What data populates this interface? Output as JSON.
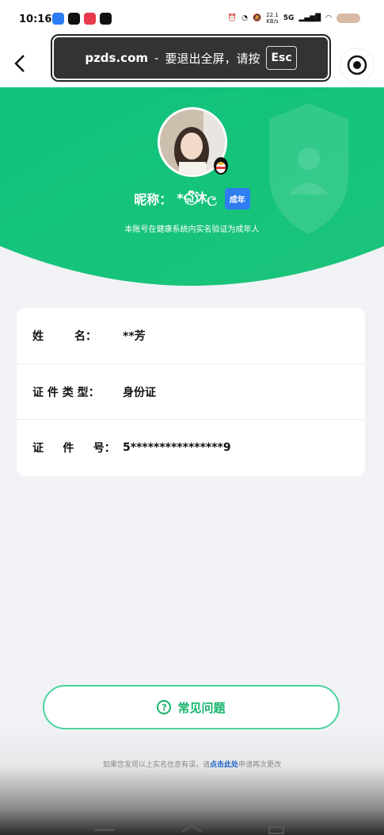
{
  "status": {
    "time": "10:16",
    "net_speed_top": "22.1",
    "net_speed_unit": "KB/s",
    "net_type": "5G"
  },
  "toast": {
    "site": "pzds.com",
    "sep": "-",
    "message": "要退出全屏，请按",
    "key": "Esc"
  },
  "profile": {
    "nick_label": "昵称：",
    "nickname": "*ଲ⃝ᩚ沐ල",
    "badge": "成年",
    "verify_text": "本账号在健康系统内实名验证为成年人"
  },
  "info": {
    "rows": [
      {
        "label": "姓        名：",
        "value": "**芳"
      },
      {
        "label": "证 件 类 型：",
        "value": "身份证"
      },
      {
        "label": "证     件     号：",
        "value": "5****************9"
      }
    ]
  },
  "faq": {
    "label": "常见问题"
  },
  "footer": {
    "text_before": "如果您发现以上实名信息有误，请",
    "link": "点击此处",
    "text_after": "申请再次更改"
  },
  "colors": {
    "brand_green": "#12c27a",
    "badge_blue": "#2f7df0",
    "link_blue": "#1f66c8"
  }
}
